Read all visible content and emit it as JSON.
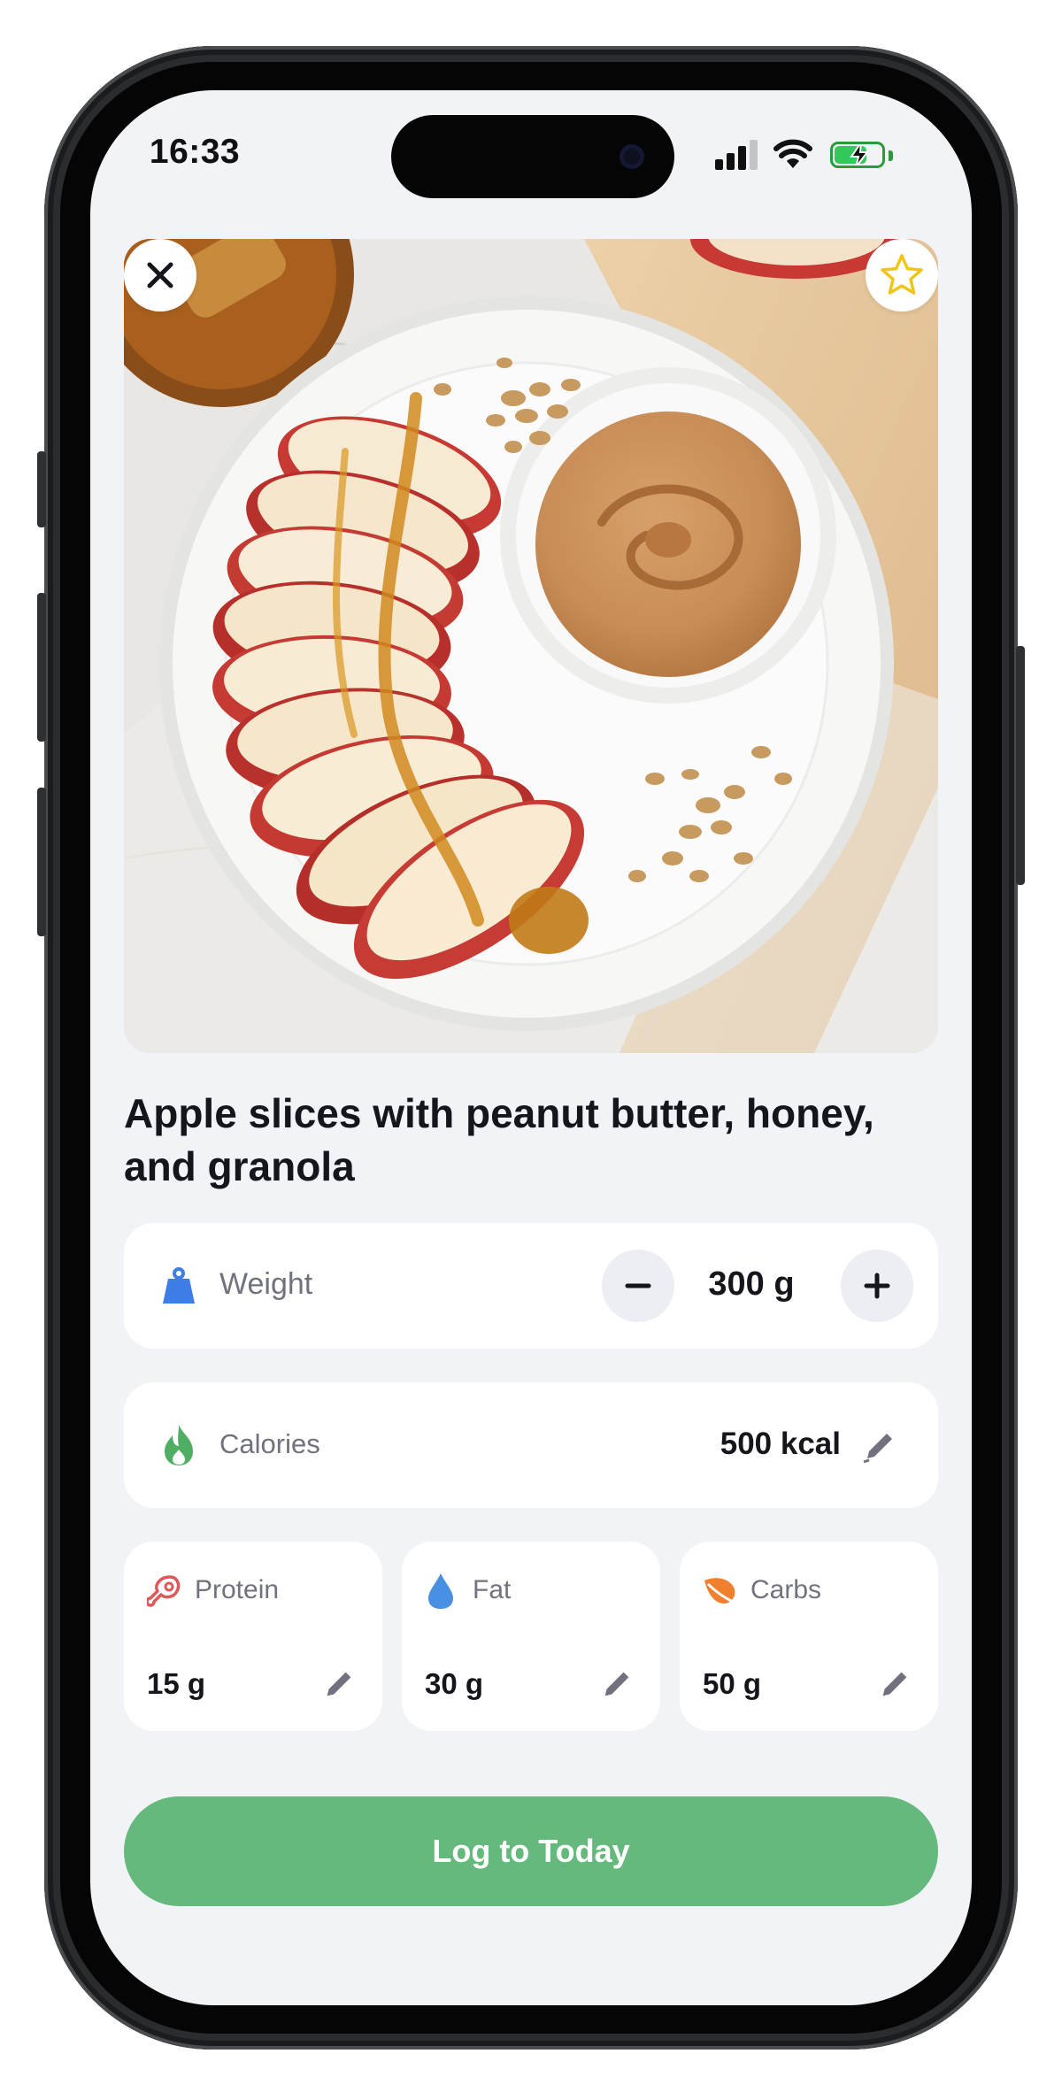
{
  "status_bar": {
    "time": "16:33"
  },
  "hero": {
    "image_alt": "Apple slices with peanut butter, honey, and granola"
  },
  "meal": {
    "title": "Apple slices with peanut butter, honey, and granola"
  },
  "weight": {
    "label": "Weight",
    "value": "300 g"
  },
  "calories": {
    "label": "Calories",
    "value": "500 kcal"
  },
  "macros": [
    {
      "label": "Protein",
      "value": "15 g",
      "icon": "meat-icon",
      "color": "#e0575b"
    },
    {
      "label": "Fat",
      "value": "30 g",
      "icon": "drop-icon",
      "color": "#4a90e2"
    },
    {
      "label": "Carbs",
      "value": "50 g",
      "icon": "leaf-icon",
      "color": "#f07f2e"
    }
  ],
  "actions": {
    "log_label": "Log to Today"
  },
  "colors": {
    "accent": "#66b97d",
    "weight_icon": "#3f7de6",
    "calories_icon": "#4fae63",
    "favorite_star": "#f0c419",
    "background": "#f2f3f7"
  }
}
